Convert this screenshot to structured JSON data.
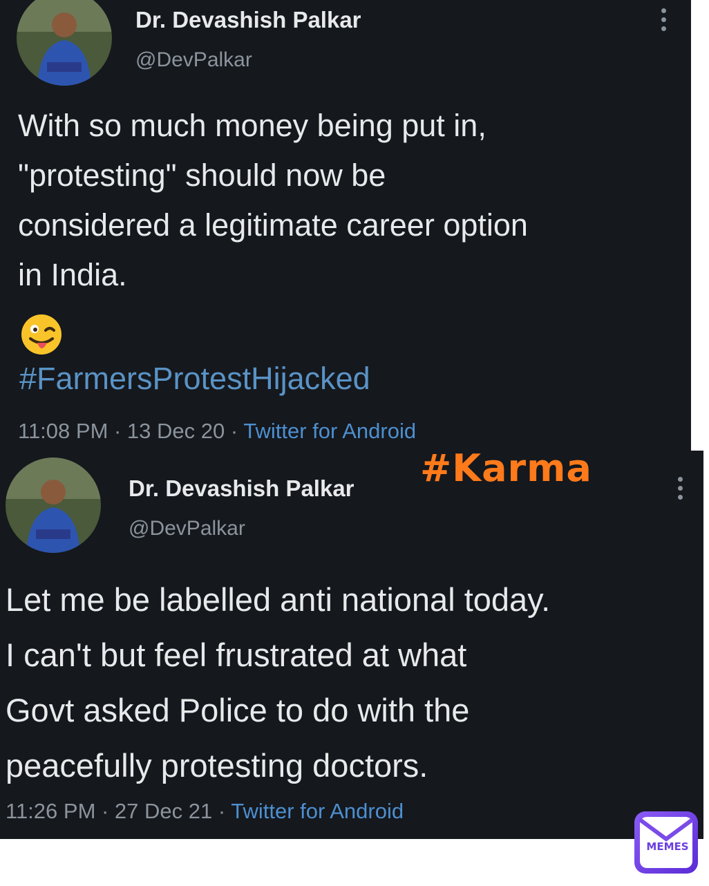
{
  "tweet1": {
    "author_name": "Dr. Devashish Palkar",
    "author_handle": "@DevPalkar",
    "text": "With so much money being put in,\n\"protesting\" should now be\nconsidered a legitimate career option\nin India.",
    "emoji": "winking-face-with-tongue",
    "hashtag": "#FarmersProtestHijacked",
    "timestamp": "11:08 PM · 13 Dec 20 · ",
    "source": "Twitter for Android"
  },
  "tweet2": {
    "author_name": "Dr. Devashish Palkar",
    "author_handle": "@DevPalkar",
    "text": "Let me be labelled anti national today.\nI can't but feel frustrated at what\nGovt asked Police to do with the\npeacefully protesting doctors.",
    "timestamp": "11:26 PM · 27 Dec 21 · ",
    "source": "Twitter for Android"
  },
  "overlay": {
    "caption": "#Karma"
  },
  "watermark": {
    "label": "MEMES"
  },
  "colors": {
    "tweet_background": "#15181d",
    "link_blue": "#4d8fd0",
    "caption_orange": "#ff7a1a",
    "logo_purple": "#6a3fe0"
  }
}
